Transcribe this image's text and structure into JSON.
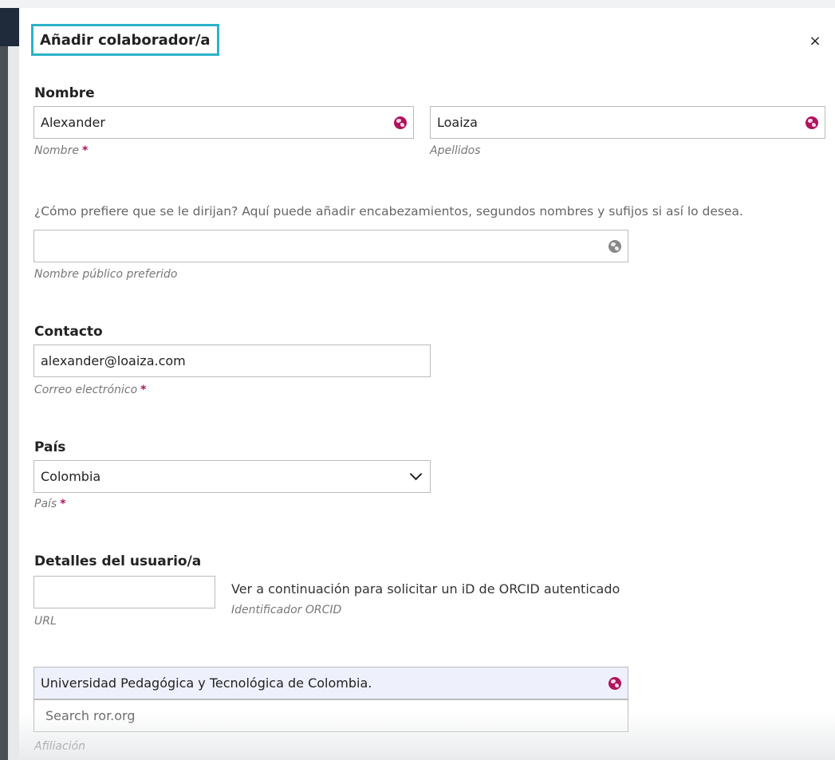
{
  "modal": {
    "title": "Añadir colaborador/a",
    "close_label": "×"
  },
  "name_section": {
    "title": "Nombre",
    "given_name": {
      "value": "Alexander",
      "label": "Nombre",
      "required": "*"
    },
    "family_name": {
      "value": "Loaiza",
      "label": "Apellidos"
    },
    "help_text": "¿Cómo prefiere que se le dirijan? Aquí puede añadir encabezamientos, segundos nombres y sufijos si así lo desea.",
    "preferred_public_name": {
      "value": "",
      "label": "Nombre público preferido"
    }
  },
  "contact_section": {
    "title": "Contacto",
    "email": {
      "value": "alexander@loaiza.com",
      "label": "Correo electrónico",
      "required": "*"
    }
  },
  "country_section": {
    "title": "País",
    "country": {
      "selected": "Colombia",
      "label": "País",
      "required": "*"
    }
  },
  "user_details_section": {
    "title": "Detalles del usuario/a",
    "url": {
      "value": "",
      "label": "URL"
    },
    "orcid_text": "Ver a continuación para solicitar un iD de ORCID autenticado",
    "orcid_label": "Identificador ORCID"
  },
  "affiliation": {
    "value": "Universidad Pedagógica y Tecnológica de Colombia.",
    "search_text": "Search ror.org",
    "label": "Afiliación"
  },
  "icons": {
    "globe_active": "globe-icon",
    "globe_inactive": "globe-icon",
    "select": "chevron-down-icon",
    "close": "close-icon"
  },
  "colors": {
    "accent_required": "#b0135f",
    "title_highlight_border": "#2bb3c8",
    "globe_active": "#b0135f",
    "globe_inactive": "#888888"
  }
}
